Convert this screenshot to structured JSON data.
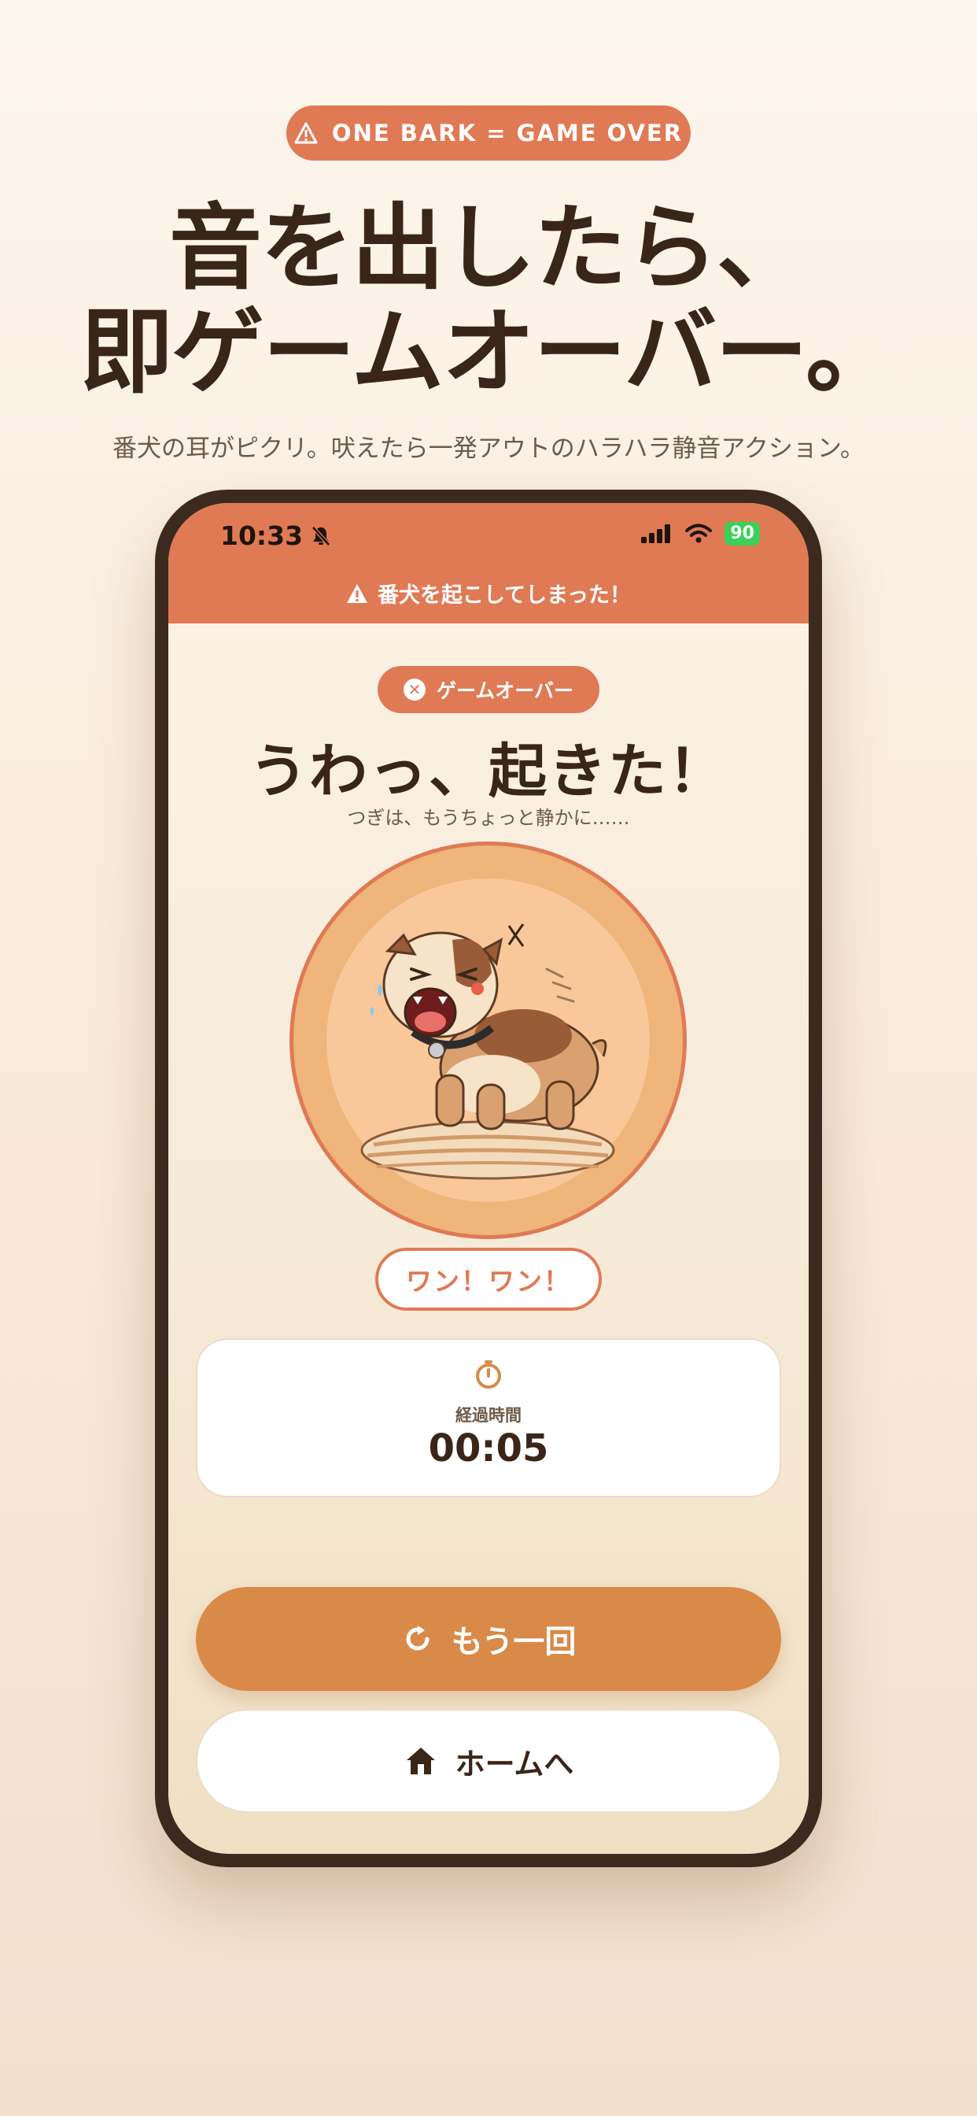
{
  "promo": {
    "pill_text": "ONE BARK = GAME OVER",
    "headline_line1": "音を出したら、",
    "headline_line2": "即ゲームオーバー。",
    "subcopy": "番犬の耳がピクリ。吠えたら一発アウトのハラハラ静音アクション。"
  },
  "status_bar": {
    "time": "10:33",
    "battery": "90"
  },
  "banner": {
    "text": "番犬を起こしてしまった！"
  },
  "result": {
    "badge": "ゲームオーバー",
    "title": "うわっ、起きた！",
    "subtitle": "つぎは、もうちょっと静かに……",
    "bark": "ワン！ワン！"
  },
  "timer": {
    "label": "経過時間",
    "value": "00:05"
  },
  "buttons": {
    "retry": "もう一回",
    "home": "ホームへ"
  },
  "colors": {
    "accent": "#e07a55",
    "primary_button": "#d98a48",
    "text_dark": "#3a2618"
  },
  "icons": {
    "warning": "warning-icon",
    "silent": "bell-slash-icon",
    "close": "x-circle-icon",
    "timer": "timer-icon",
    "retry": "retry-icon",
    "home": "home-icon"
  }
}
